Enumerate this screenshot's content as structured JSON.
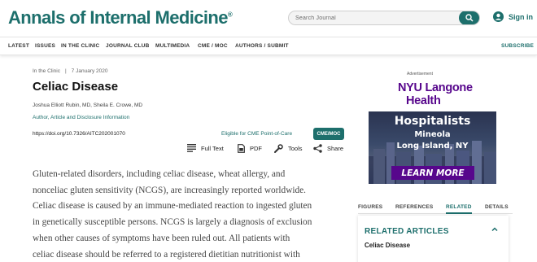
{
  "header": {
    "logo_text": "Annals of Internal Medicine",
    "logo_mark": "®",
    "search_placeholder": "Search Journal",
    "signin_label": "Sign in"
  },
  "nav": {
    "items": [
      "LATEST",
      "ISSUES",
      "IN THE CLINIC",
      "JOURNAL CLUB",
      "MULTIMEDIA",
      "CME / MOC",
      "AUTHORS / SUBMIT"
    ],
    "subscribe": "SUBSCRIBE"
  },
  "article": {
    "section": "In the Clinic",
    "separator": "|",
    "date": "7 January 2020",
    "title": "Celiac Disease",
    "authors": "Joshua Elliott Rubin, MD, Sheila E. Crowe, MD",
    "disclosure_link": "Author, Article and Disclosure Information",
    "doi": "https://doi.org/10.7326/AITC202001070",
    "cme_text": "Eligible for CME Point-of-Care",
    "cme_badge": "CME/MOC",
    "tools": {
      "full_text": "Full Text",
      "pdf": "PDF",
      "tools": "Tools",
      "share": "Share"
    },
    "abstract_lines": [
      "Gluten-related disorders, including celiac disease, wheat allergy, and",
      "nonceliac gluten sensitivity (NCGS), are increasingly reported worldwide.",
      "Celiac disease is caused by an immune-mediated reaction to ingested gluten",
      "in genetically susceptible persons. NCGS is largely a diagnosis of exclusion",
      "when other causes of symptoms have been ruled out. All patients with",
      "celiac disease should be referred to a registered dietitian nutritionist with"
    ]
  },
  "ad": {
    "label": "Advertisement",
    "logo_line1": "NYU Langone",
    "logo_line2": "Health",
    "headline": "Hospitalists",
    "line2": "Mineola",
    "line3": "Long Island, NY",
    "cta": "LEARN MORE"
  },
  "sidebar": {
    "tabs": [
      "FIGURES",
      "REFERENCES",
      "RELATED",
      "DETAILS"
    ],
    "active_tab": "RELATED",
    "related_title": "RELATED ARTICLES",
    "related_items": [
      "Celiac Disease"
    ]
  },
  "colors": {
    "brand": "#1d6f6c",
    "ad_purple": "#57068c"
  }
}
